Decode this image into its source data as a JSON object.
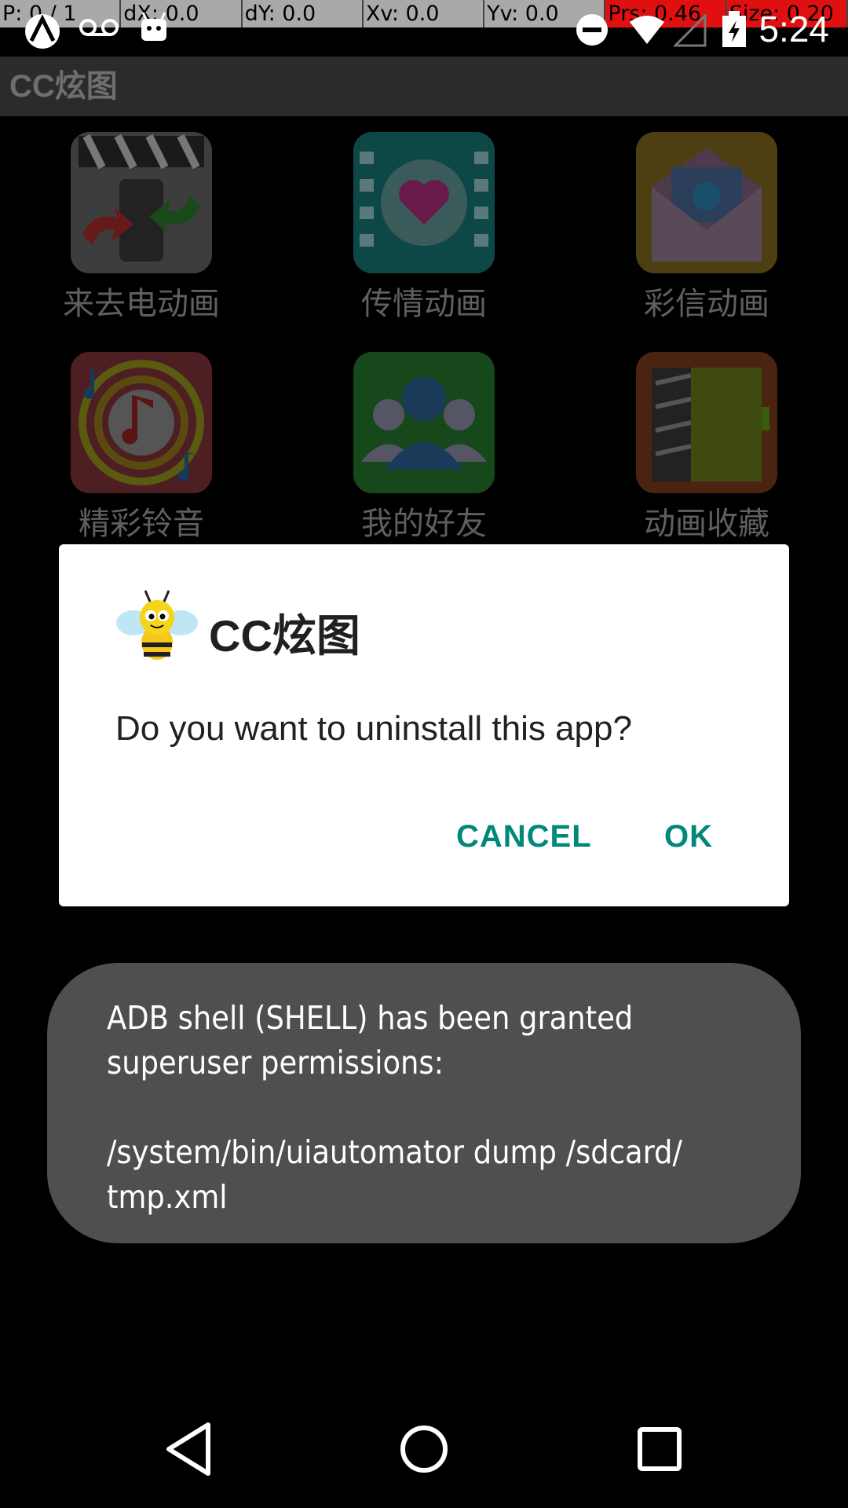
{
  "debug_bar": {
    "cells": [
      {
        "text": "P: 0 / 1",
        "highlight": false
      },
      {
        "text": "dX: 0.0",
        "highlight": false
      },
      {
        "text": "dY: 0.0",
        "highlight": false
      },
      {
        "text": "Xv: 0.0",
        "highlight": false
      },
      {
        "text": "Yv: 0.0",
        "highlight": false
      },
      {
        "text": "Prs: 0.46",
        "highlight": true
      },
      {
        "text": "Size: 0.20",
        "highlight": true
      }
    ]
  },
  "status_bar": {
    "time": "5:24",
    "icons": [
      "android-icon",
      "voicemail-icon",
      "android-robot-icon",
      "do-not-disturb-icon",
      "wifi-icon",
      "no-signal-icon",
      "battery-charging-icon"
    ]
  },
  "app": {
    "title": "CC炫图",
    "tiles": [
      {
        "label": "来去电动画",
        "icon": "clapperboard-phone-icon"
      },
      {
        "label": "传情动画",
        "icon": "film-heart-icon"
      },
      {
        "label": "彩信动画",
        "icon": "envelope-bird-icon"
      },
      {
        "label": "精彩铃音",
        "icon": "music-note-icon"
      },
      {
        "label": "我的好友",
        "icon": "friends-icon"
      },
      {
        "label": "动画收藏",
        "icon": "collection-book-icon"
      }
    ]
  },
  "dialog": {
    "title": "CC炫图",
    "icon": "bee-icon",
    "message": "Do you want to uninstall this app?",
    "cancel_label": "CANCEL",
    "ok_label": "OK",
    "accent_color": "#00897b"
  },
  "toast": {
    "text": "ADB shell (SHELL) has been granted superuser permissions:\n\n/system/bin/uiautomator dump /sdcard/\ntmp.xml"
  },
  "nav_bar": {
    "icons": [
      "back-icon",
      "home-icon",
      "recents-icon"
    ]
  }
}
